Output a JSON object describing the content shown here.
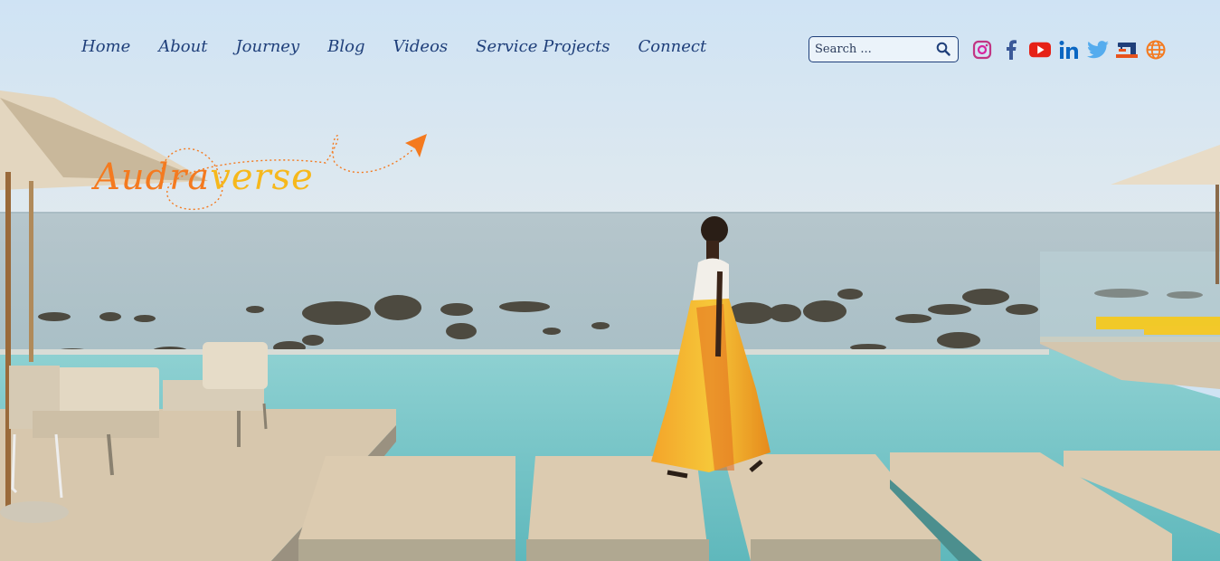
{
  "nav": {
    "items": [
      {
        "label": "Home"
      },
      {
        "label": "About"
      },
      {
        "label": "Journey"
      },
      {
        "label": "Blog"
      },
      {
        "label": "Videos"
      },
      {
        "label": "Service Projects"
      },
      {
        "label": "Connect"
      }
    ]
  },
  "search": {
    "placeholder": "Search ..."
  },
  "social": [
    "instagram-icon",
    "facebook-icon",
    "youtube-icon",
    "linkedin-icon",
    "twitter-icon",
    "sewing-machine-icon",
    "globe-icon"
  ],
  "logo": {
    "part1": "Audra",
    "part2": "verse"
  },
  "colors": {
    "nav": "#1f3f7a",
    "logo_orange": "#f47a1f",
    "logo_yellow": "#f6b81c"
  }
}
